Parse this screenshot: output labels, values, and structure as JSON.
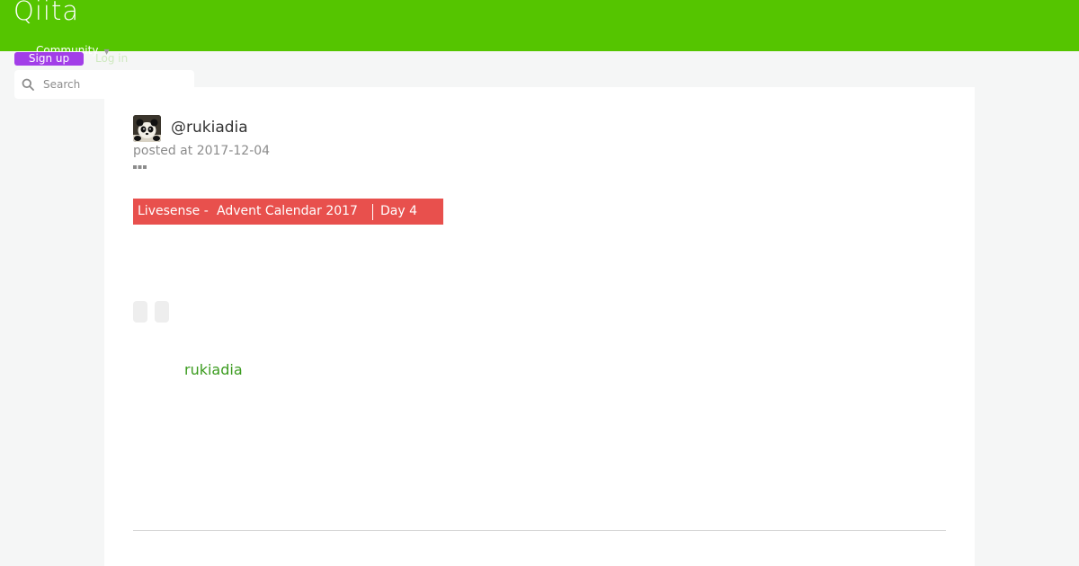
{
  "header": {
    "logo_text": "Qiita",
    "community_label": "Community",
    "signup_label": "Sign up",
    "login_label": "Log in",
    "brand_color": "#55c500",
    "signup_color": "#a23ee8"
  },
  "search": {
    "placeholder": "Search",
    "value": ""
  },
  "article": {
    "author_handle": "@rukiadia",
    "posted_text": "posted at 2017-12-04",
    "advent": {
      "organization": "Livesense",
      "separator": "-",
      "calendar": "Advent Calendar 2017",
      "day": "Day 4",
      "color": "#e8504d"
    },
    "footer_author": "rukiadia"
  },
  "icons": {
    "search": "search-icon",
    "more": "more-options-icon",
    "caret": "chevron-down-icon",
    "avatar": "panda-avatar"
  }
}
